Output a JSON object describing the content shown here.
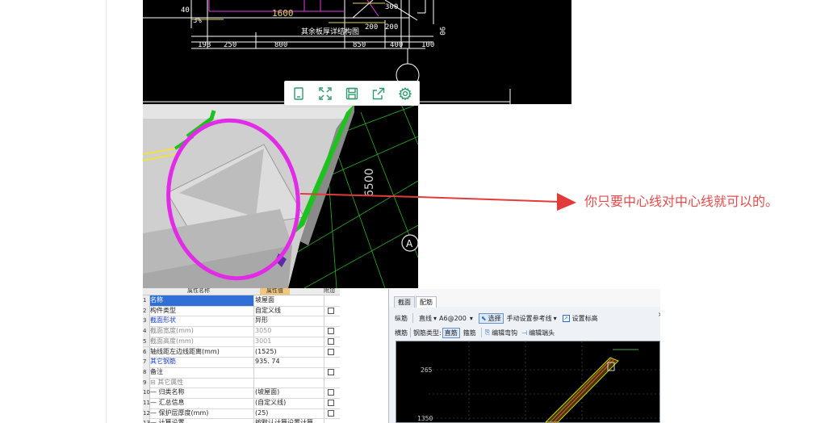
{
  "cad_drawing": {
    "dims_bottom": [
      "198",
      "250",
      "800",
      "850",
      "400",
      "100"
    ],
    "dims_mid": [
      "200",
      "200"
    ],
    "label_1600": "1600",
    "label_300": "300",
    "label_90": "90",
    "label_300_top": "300",
    "label_note": "其余板厚详结构图",
    "left_label": "3%",
    "left_label2": "40"
  },
  "image_toolbar": {
    "items": [
      {
        "icon": "tablet-icon"
      },
      {
        "icon": "fullscreen-icon"
      },
      {
        "icon": "save-icon"
      },
      {
        "icon": "share-icon"
      },
      {
        "icon": "gear-icon"
      }
    ]
  },
  "render_3d": {
    "dimension_label": "6500",
    "axis_label": "A",
    "colors": {
      "highlight_circle": "#e22be6",
      "rebar_green": "#1ec21e",
      "annot_arrow": "#e23b3b"
    }
  },
  "annotation": {
    "text": "你只要中心线对中心线就可以的。"
  },
  "property_table": {
    "headers": [
      "属性名称",
      "属性值",
      "附加"
    ],
    "rows": [
      {
        "num": "1",
        "name": "名称",
        "value": "坡屋面",
        "checkbox": false,
        "selected": true
      },
      {
        "num": "2",
        "name": "构件类型",
        "value": "自定义线",
        "checkbox": true
      },
      {
        "num": "3",
        "name": "截面形状",
        "value": "异形",
        "checkbox": false,
        "blue": true
      },
      {
        "num": "4",
        "name": "截面宽度(mm)",
        "value": "3050",
        "checkbox": true,
        "gray": true
      },
      {
        "num": "5",
        "name": "截面高度(mm)",
        "value": "3001",
        "checkbox": true,
        "gray": true
      },
      {
        "num": "6",
        "name": "轴线距左边线距离(mm)",
        "value": "(1525)",
        "checkbox": true
      },
      {
        "num": "7",
        "name": "其它钢筋",
        "value": "935. 74",
        "checkbox": false,
        "blue": true
      },
      {
        "num": "8",
        "name": "备注",
        "value": "",
        "checkbox": true
      },
      {
        "num": "9",
        "name": "⊟ 其它属性",
        "value": "",
        "checkbox": false,
        "gray": true
      },
      {
        "num": "10",
        "name": "— 归类名称",
        "value": "(坡屋面)",
        "checkbox": true
      },
      {
        "num": "11",
        "name": "— 汇总信息",
        "value": "(自定义线)",
        "checkbox": true
      },
      {
        "num": "12",
        "name": "— 保护层厚度(mm)",
        "value": "(25)",
        "checkbox": true
      },
      {
        "num": "13",
        "name": "— 计算设置",
        "value": "按默认计算设置计算",
        "checkbox": false
      }
    ]
  },
  "rebar_editor": {
    "tabs": [
      "截面",
      "配筋"
    ],
    "active_tab": "配筋",
    "row1": {
      "longitudinal": "纵筋",
      "line_type": "直线",
      "spec": "A6@200",
      "select": "选择",
      "manual_ref": "手动设置参考线",
      "set_elevation": "设置标高"
    },
    "row2": {
      "horizontal": "横筋",
      "rebar_type": "钢筋类型:",
      "straight": "直筋",
      "stirrup": "箍筋",
      "edit_bend": "编辑弯钩",
      "edit_end": "编辑端头"
    },
    "canvas_labels": [
      "265",
      "1350"
    ]
  }
}
